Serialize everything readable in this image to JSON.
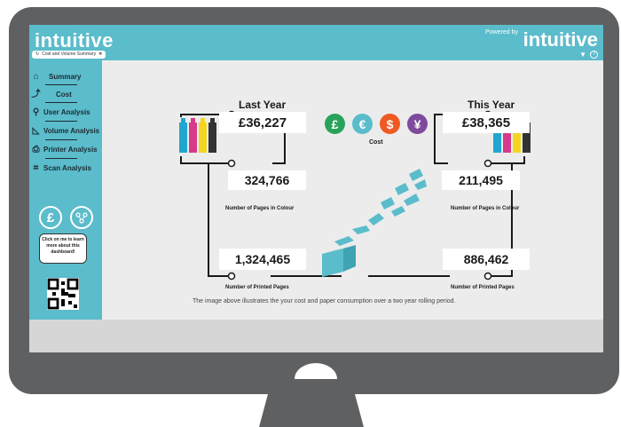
{
  "brand": {
    "logo_text": "intuitive",
    "powered_by": "Powered by",
    "powered_logo": "intuitive",
    "accent": "#5bbccb"
  },
  "header": {
    "tab_label": "Cost and Volume Summary",
    "filter_icon": "filter-icon",
    "help_icon": "help-icon"
  },
  "sidebar": {
    "items": [
      {
        "label": "Summary",
        "icon": "home-icon"
      },
      {
        "label": "Cost",
        "icon": "trend-icon"
      },
      {
        "label": "User Analysis",
        "icon": "user-search-icon"
      },
      {
        "label": "Volume Analysis",
        "icon": "volume-chart-icon"
      },
      {
        "label": "Printer Analysis",
        "icon": "printer-icon"
      },
      {
        "label": "Scan Analysis",
        "icon": "scan-icon"
      }
    ],
    "currency_symbol": "£",
    "bubble_text": "Click on me to learn more about this dashboard!"
  },
  "main": {
    "last_year": {
      "title": "Last Year",
      "cost": "£36,227",
      "colour_pages": "324,766",
      "printed_pages": "1,324,465"
    },
    "this_year": {
      "title": "This Year",
      "cost": "£38,365",
      "colour_pages": "211,495",
      "printed_pages": "886,462"
    },
    "currency_symbols": [
      {
        "symbol": "£",
        "color": "#2aa35a"
      },
      {
        "symbol": "€",
        "color": "#5bbccb"
      },
      {
        "symbol": "$",
        "color": "#f05a22"
      },
      {
        "symbol": "¥",
        "color": "#7e4a9c"
      }
    ],
    "cost_label": "Cost",
    "colour_caption": "Number of Pages in Colour",
    "printed_caption": "Number of Printed Pages",
    "footnote": "The image above illustrates the your cost and paper consumption over a two year rolling period."
  }
}
